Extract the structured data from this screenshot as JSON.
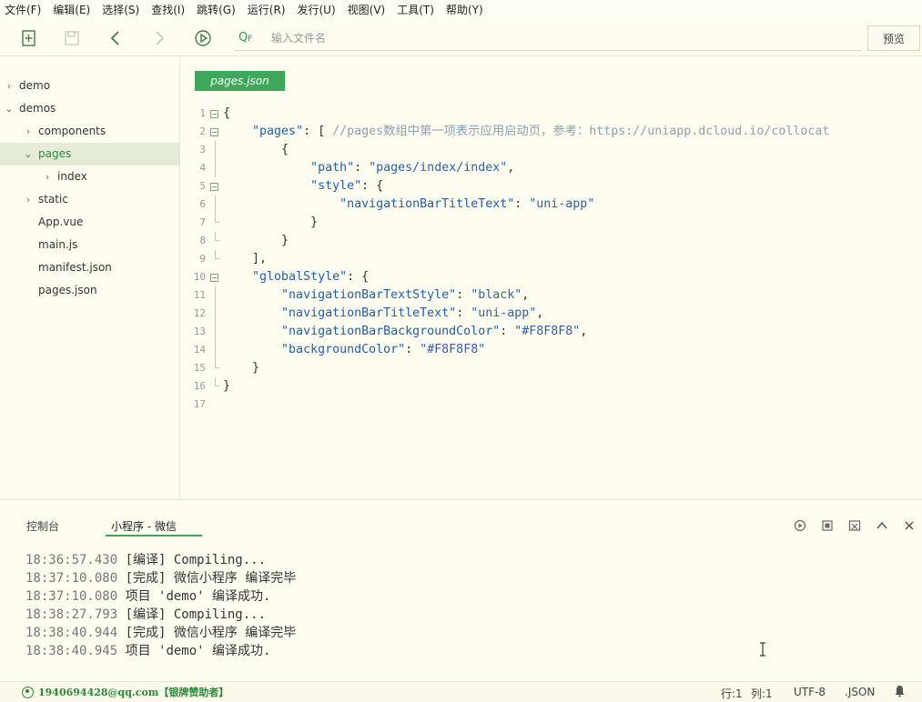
{
  "menu": [
    "文件(F)",
    "编辑(E)",
    "选择(S)",
    "查找(I)",
    "跳转(G)",
    "运行(R)",
    "发行(U)",
    "视图(V)",
    "工具(T)",
    "帮助(Y)"
  ],
  "toolbar": {
    "search_prefix": "QF",
    "search_placeholder": "输入文件名",
    "preview_label": "预览"
  },
  "sidebar": {
    "items": [
      {
        "label": "demo",
        "depth": 0,
        "arrow": "›"
      },
      {
        "label": "demos",
        "depth": 0,
        "arrow": "⌄"
      },
      {
        "label": "components",
        "depth": 1,
        "arrow": "›"
      },
      {
        "label": "pages",
        "depth": 1,
        "arrow": "⌄",
        "active": true
      },
      {
        "label": "index",
        "depth": 2,
        "arrow": "›"
      },
      {
        "label": "static",
        "depth": 1,
        "arrow": "›"
      },
      {
        "label": "App.vue",
        "depth": 1,
        "arrow": ""
      },
      {
        "label": "main.js",
        "depth": 1,
        "arrow": ""
      },
      {
        "label": "manifest.json",
        "depth": 1,
        "arrow": ""
      },
      {
        "label": "pages.json",
        "depth": 1,
        "arrow": ""
      }
    ]
  },
  "editor": {
    "tab_label": "pages.json",
    "lines": [
      {
        "n": "1",
        "html": "<span class=\"p\">{</span>"
      },
      {
        "n": "2",
        "html": "    <span class=\"k\">\"pages\"</span><span class=\"p\">: [ </span><span class=\"cm\">//pages数组中第一项表示应用启动页，参考：https://uniapp.dcloud.io/collocat</span>"
      },
      {
        "n": "3",
        "html": "        <span class=\"p\">{</span>"
      },
      {
        "n": "4",
        "html": "            <span class=\"k\">\"path\"</span><span class=\"p\">: </span><span class=\"str\">\"pages/index/index\"</span><span class=\"p\">,</span>"
      },
      {
        "n": "5",
        "html": "            <span class=\"k\">\"style\"</span><span class=\"p\">: {</span>"
      },
      {
        "n": "6",
        "html": "                <span class=\"k\">\"navigationBarTitleText\"</span><span class=\"p\">: </span><span class=\"str\">\"uni-app\"</span>"
      },
      {
        "n": "7",
        "html": "            <span class=\"p\">}</span>"
      },
      {
        "n": "8",
        "html": "        <span class=\"p\">}</span>"
      },
      {
        "n": "9",
        "html": "    <span class=\"p\">],</span>"
      },
      {
        "n": "10",
        "html": "    <span class=\"k\">\"globalStyle\"</span><span class=\"p\">: {</span>"
      },
      {
        "n": "11",
        "html": "        <span class=\"k\">\"navigationBarTextStyle\"</span><span class=\"p\">: </span><span class=\"str\">\"black\"</span><span class=\"p\">,</span>"
      },
      {
        "n": "12",
        "html": "        <span class=\"k\">\"navigationBarTitleText\"</span><span class=\"p\">: </span><span class=\"str\">\"uni-app\"</span><span class=\"p\">,</span>"
      },
      {
        "n": "13",
        "html": "        <span class=\"k\">\"navigationBarBackgroundColor\"</span><span class=\"p\">: </span><span class=\"str\">\"#F8F8F8\"</span><span class=\"p\">,</span>"
      },
      {
        "n": "14",
        "html": "        <span class=\"k\">\"backgroundColor\"</span><span class=\"p\">: </span><span class=\"str\">\"#F8F8F8\"</span>"
      },
      {
        "n": "15",
        "html": "    <span class=\"p\">}</span>"
      },
      {
        "n": "16",
        "html": "<span class=\"p\">}</span>"
      },
      {
        "n": "17",
        "html": ""
      }
    ]
  },
  "console": {
    "tabs": [
      "控制台",
      "小程序 - 微信"
    ],
    "logs": [
      {
        "ts": "18:36:57.430",
        "msg": " [编译] Compiling..."
      },
      {
        "ts": "18:37:10.080",
        "msg": " [完成] 微信小程序 编译完毕"
      },
      {
        "ts": "18:37:10.080",
        "msg": " 项目 'demo' 编译成功."
      },
      {
        "ts": "18:38:27.793",
        "msg": " [编译] Compiling..."
      },
      {
        "ts": "18:38:40.944",
        "msg": " [完成] 微信小程序 编译完毕"
      },
      {
        "ts": "18:38:40.945",
        "msg": " 项目 'demo' 编译成功."
      }
    ]
  },
  "status": {
    "user": "1940694428@qq.com【银牌赞助者】",
    "row": "行:1",
    "col": "列:1",
    "encoding": "UTF-8",
    "syntax": ".JSON"
  },
  "colors": {
    "accent": "#3fa75a",
    "background": "#fffdf0"
  }
}
